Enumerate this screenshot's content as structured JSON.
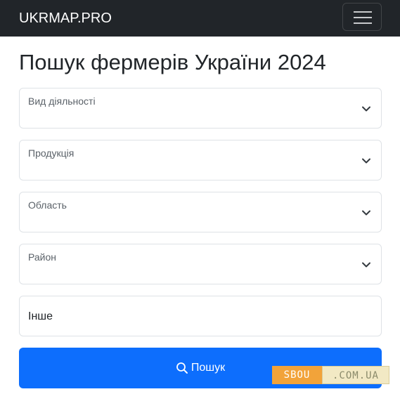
{
  "navbar": {
    "brand": "UKRMAP.PRO",
    "menu_icon": "hamburger-menu-icon"
  },
  "page": {
    "title": "Пошук фермерів України 2024"
  },
  "form": {
    "activity": {
      "label": "Вид діяльності",
      "value": ""
    },
    "products": {
      "label": "Продукція",
      "value": ""
    },
    "region": {
      "label": "Область",
      "value": ""
    },
    "district": {
      "label": "Район",
      "value": ""
    },
    "other": {
      "value": "Інше"
    },
    "search_button": {
      "label": "Пошук",
      "icon": "search-icon"
    }
  },
  "watermark": {
    "left": "SBOU",
    "right": ".COM.UA"
  },
  "colors": {
    "navbar_bg": "#212529",
    "primary": "#0d6efd",
    "watermark_orange": "#f2a33a"
  }
}
